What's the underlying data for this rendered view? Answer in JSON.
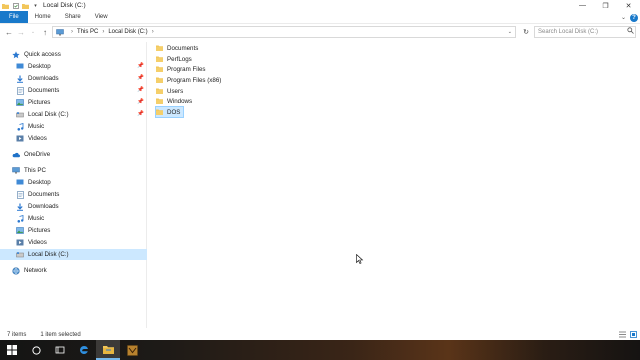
{
  "window": {
    "title": "Local Disk (C:)",
    "controls": {
      "minimize": "—",
      "maximize": "❐",
      "close": "✕"
    }
  },
  "ribbon": {
    "tabs": [
      "File",
      "Home",
      "Share",
      "View"
    ],
    "expand_icon": "chevron-down-icon",
    "help_label": "?"
  },
  "address": {
    "segments": [
      "This PC",
      "Local Disk (C:)"
    ],
    "search_placeholder": "Search Local Disk (C:)"
  },
  "sidebar": {
    "quick_access": "Quick access",
    "quick_items": [
      {
        "label": "Desktop",
        "icon": "desktop-icon",
        "pinned": true
      },
      {
        "label": "Downloads",
        "icon": "downloads-icon",
        "pinned": true
      },
      {
        "label": "Documents",
        "icon": "documents-icon",
        "pinned": true
      },
      {
        "label": "Pictures",
        "icon": "pictures-icon",
        "pinned": true
      },
      {
        "label": "Local Disk (C:)",
        "icon": "drive-icon",
        "pinned": true
      },
      {
        "label": "Music",
        "icon": "music-icon",
        "pinned": false
      },
      {
        "label": "Videos",
        "icon": "videos-icon",
        "pinned": false
      }
    ],
    "onedrive": "OneDrive",
    "this_pc": "This PC",
    "pc_items": [
      {
        "label": "Desktop",
        "icon": "desktop-icon"
      },
      {
        "label": "Documents",
        "icon": "documents-icon"
      },
      {
        "label": "Downloads",
        "icon": "downloads-icon"
      },
      {
        "label": "Music",
        "icon": "music-icon"
      },
      {
        "label": "Pictures",
        "icon": "pictures-icon"
      },
      {
        "label": "Videos",
        "icon": "videos-icon"
      },
      {
        "label": "Local Disk (C:)",
        "icon": "drive-icon",
        "selected": true
      }
    ],
    "network": "Network"
  },
  "files": [
    {
      "name": "Documents",
      "selected": false
    },
    {
      "name": "PerfLogs",
      "selected": false
    },
    {
      "name": "Program Files",
      "selected": false
    },
    {
      "name": "Program Files (x86)",
      "selected": false
    },
    {
      "name": "Users",
      "selected": false
    },
    {
      "name": "Windows",
      "selected": false
    },
    {
      "name": "DOS",
      "selected": true
    }
  ],
  "status": {
    "item_count": "7 items",
    "selection": "1 item selected"
  },
  "taskbar": {
    "items": [
      "start-icon",
      "cortana-icon",
      "task-view-icon",
      "edge-icon",
      "file-explorer-icon",
      "app-icon"
    ]
  },
  "colors": {
    "accent": "#1979ca",
    "selection": "#cce8ff",
    "folder": "#f2c65a"
  }
}
